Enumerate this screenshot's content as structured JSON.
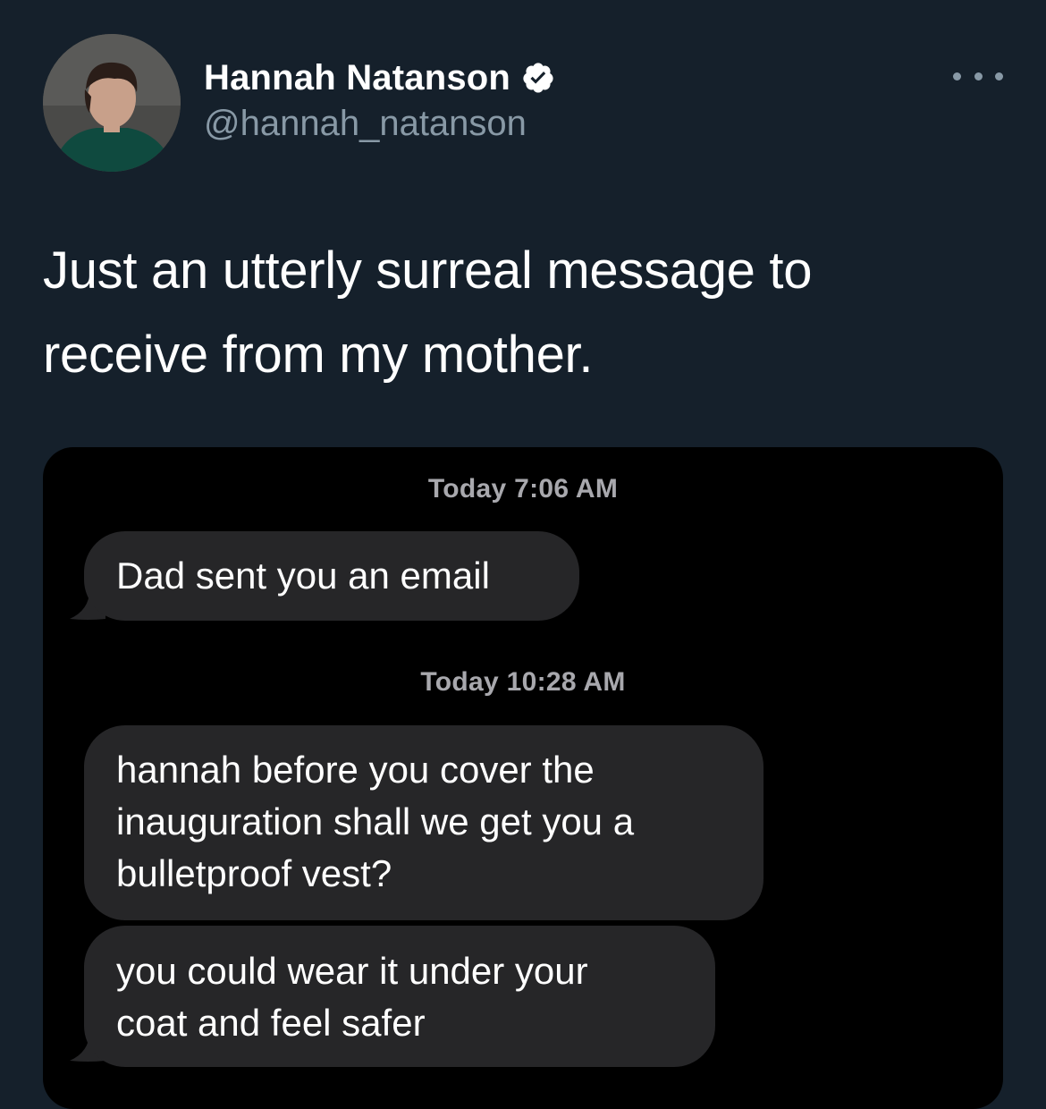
{
  "tweet": {
    "display_name": "Hannah Natanson",
    "handle": "@hannah_natanson",
    "text": "Just an utterly surreal message to receive from my mother.",
    "more_icon": "more-horizontal-icon",
    "verified_icon": "verified-badge-icon"
  },
  "screenshot": {
    "timestamps": [
      "Today 7:06 AM",
      "Today 10:28 AM"
    ],
    "messages": [
      {
        "line1": "Dad sent you an email"
      },
      {
        "line1": "hannah before you cover the",
        "line2": "inauguration shall we get you a",
        "line3": "bulletproof vest?"
      },
      {
        "line1": "you could wear it under your",
        "line2": "coat and feel safer"
      }
    ]
  },
  "colors": {
    "background": "#15202b",
    "secondary_text": "#8899a6",
    "verified_blue": "#ffffff",
    "bubble_gray": "#262628",
    "media_background": "#000000"
  }
}
